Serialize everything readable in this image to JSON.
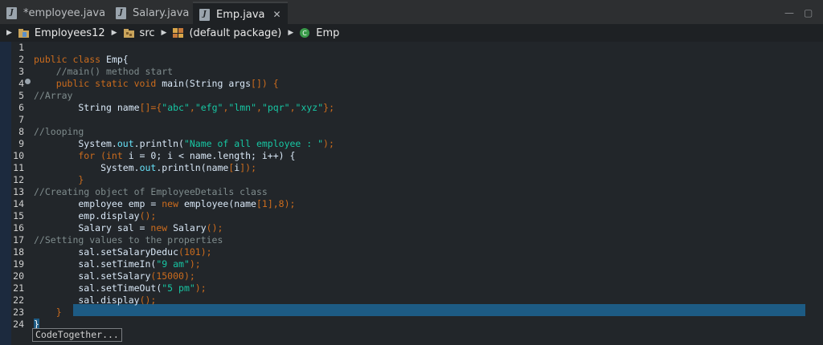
{
  "tabs": [
    {
      "label": "*employee.java"
    },
    {
      "label": "Salary.java"
    },
    {
      "label": "Emp.java"
    }
  ],
  "window_controls": {
    "minimize": "—",
    "maximize": "▢"
  },
  "breadcrumb": [
    "Employees12",
    "src",
    "(default package)",
    "Emp"
  ],
  "colors": {
    "keyword": "#cc6c1d",
    "comment": "#7f8c8d",
    "string": "#17c6a3",
    "selection": "#1d5b84"
  },
  "code_lines": [
    {
      "n": "1"
    },
    {
      "n": "2"
    },
    {
      "n": "3"
    },
    {
      "n": "4"
    },
    {
      "n": "5"
    },
    {
      "n": "6"
    },
    {
      "n": "7"
    },
    {
      "n": "8"
    },
    {
      "n": "9"
    },
    {
      "n": "10"
    },
    {
      "n": "11"
    },
    {
      "n": "12"
    },
    {
      "n": "13"
    },
    {
      "n": "14"
    },
    {
      "n": "15"
    },
    {
      "n": "16"
    },
    {
      "n": "17"
    },
    {
      "n": "18"
    },
    {
      "n": "19"
    },
    {
      "n": "20"
    },
    {
      "n": "21"
    },
    {
      "n": "22"
    },
    {
      "n": "23"
    },
    {
      "n": "24"
    }
  ],
  "code": {
    "l2a": "public class ",
    "l2b": "Emp{",
    "l3": "    //main() method start",
    "l4a": "    public static void ",
    "l4b": "main(String args",
    "l4c": "[]) {",
    "l5": "//Array",
    "l6a": "        String name",
    "l6b": "[]={",
    "l6c": "\"abc\"",
    "l6d": ",",
    "l6e": "\"efg\"",
    "l6f": ",",
    "l6g": "\"lmn\"",
    "l6h": ",",
    "l6i": "\"pqr\"",
    "l6j": ",",
    "l6k": "\"xyz\"",
    "l6l": "};",
    "l8": "//looping",
    "l9a": "        System.",
    "l9b": "out",
    "l9c": ".println(",
    "l9d": "\"Name of all employee : \"",
    "l9e": ");",
    "l10a": "        for (int ",
    "l10b": "i = 0; i < name.length; i++) {",
    "l11a": "            System.",
    "l11b": "out",
    "l11c": ".println(name",
    "l11d": "[",
    "l11e": "i",
    "l11f": "]);",
    "l12": "        }",
    "l13": "//Creating object of EmployeeDetails class",
    "l14a": "        employee emp = ",
    "l14b": "new ",
    "l14c": "employee(name",
    "l14d": "[1]",
    "l14e": ",8);",
    "l15a": "        emp.display",
    "l15b": "();",
    "l16a": "        Salary sal = ",
    "l16b": "new ",
    "l16c": "Salary",
    "l16d": "();",
    "l17": "//Setting values to the properties",
    "l18a": "        sal.setSalaryDeduc",
    "l18b": "(101);",
    "l19a": "        sal.setTimeIn(",
    "l19b": "\"9 am\"",
    "l19c": ");",
    "l20a": "        sal.setSalary",
    "l20b": "(15000);",
    "l21a": "        sal.setTimeOut(",
    "l21b": "\"5 pm\"",
    "l21c": ");",
    "l22a": "        sal.display",
    "l22b": "();",
    "l23": "    }",
    "l24": "}"
  },
  "autocomplete": {
    "label": "CodeTogether..."
  }
}
